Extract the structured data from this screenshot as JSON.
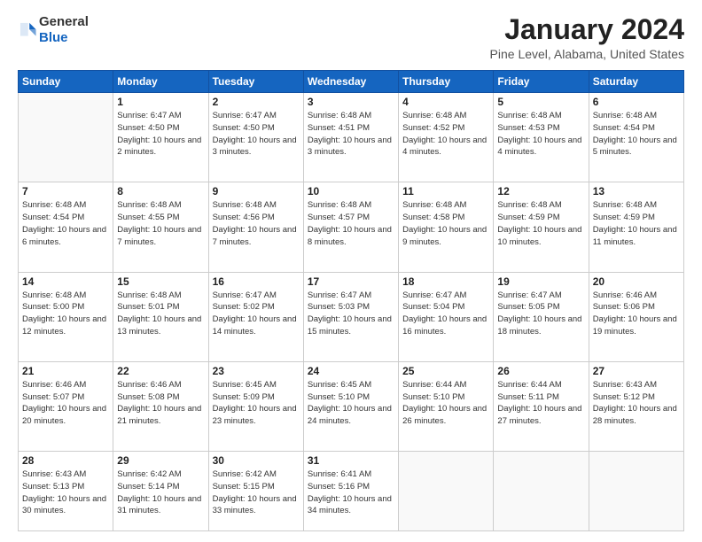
{
  "logo": {
    "general": "General",
    "blue": "Blue"
  },
  "header": {
    "month": "January 2024",
    "location": "Pine Level, Alabama, United States"
  },
  "weekdays": [
    "Sunday",
    "Monday",
    "Tuesday",
    "Wednesday",
    "Thursday",
    "Friday",
    "Saturday"
  ],
  "weeks": [
    [
      {
        "day": "",
        "sunrise": "",
        "sunset": "",
        "daylight": ""
      },
      {
        "day": "1",
        "sunrise": "Sunrise: 6:47 AM",
        "sunset": "Sunset: 4:50 PM",
        "daylight": "Daylight: 10 hours and 2 minutes."
      },
      {
        "day": "2",
        "sunrise": "Sunrise: 6:47 AM",
        "sunset": "Sunset: 4:50 PM",
        "daylight": "Daylight: 10 hours and 3 minutes."
      },
      {
        "day": "3",
        "sunrise": "Sunrise: 6:48 AM",
        "sunset": "Sunset: 4:51 PM",
        "daylight": "Daylight: 10 hours and 3 minutes."
      },
      {
        "day": "4",
        "sunrise": "Sunrise: 6:48 AM",
        "sunset": "Sunset: 4:52 PM",
        "daylight": "Daylight: 10 hours and 4 minutes."
      },
      {
        "day": "5",
        "sunrise": "Sunrise: 6:48 AM",
        "sunset": "Sunset: 4:53 PM",
        "daylight": "Daylight: 10 hours and 4 minutes."
      },
      {
        "day": "6",
        "sunrise": "Sunrise: 6:48 AM",
        "sunset": "Sunset: 4:54 PM",
        "daylight": "Daylight: 10 hours and 5 minutes."
      }
    ],
    [
      {
        "day": "7",
        "sunrise": "Sunrise: 6:48 AM",
        "sunset": "Sunset: 4:54 PM",
        "daylight": "Daylight: 10 hours and 6 minutes."
      },
      {
        "day": "8",
        "sunrise": "Sunrise: 6:48 AM",
        "sunset": "Sunset: 4:55 PM",
        "daylight": "Daylight: 10 hours and 7 minutes."
      },
      {
        "day": "9",
        "sunrise": "Sunrise: 6:48 AM",
        "sunset": "Sunset: 4:56 PM",
        "daylight": "Daylight: 10 hours and 7 minutes."
      },
      {
        "day": "10",
        "sunrise": "Sunrise: 6:48 AM",
        "sunset": "Sunset: 4:57 PM",
        "daylight": "Daylight: 10 hours and 8 minutes."
      },
      {
        "day": "11",
        "sunrise": "Sunrise: 6:48 AM",
        "sunset": "Sunset: 4:58 PM",
        "daylight": "Daylight: 10 hours and 9 minutes."
      },
      {
        "day": "12",
        "sunrise": "Sunrise: 6:48 AM",
        "sunset": "Sunset: 4:59 PM",
        "daylight": "Daylight: 10 hours and 10 minutes."
      },
      {
        "day": "13",
        "sunrise": "Sunrise: 6:48 AM",
        "sunset": "Sunset: 4:59 PM",
        "daylight": "Daylight: 10 hours and 11 minutes."
      }
    ],
    [
      {
        "day": "14",
        "sunrise": "Sunrise: 6:48 AM",
        "sunset": "Sunset: 5:00 PM",
        "daylight": "Daylight: 10 hours and 12 minutes."
      },
      {
        "day": "15",
        "sunrise": "Sunrise: 6:48 AM",
        "sunset": "Sunset: 5:01 PM",
        "daylight": "Daylight: 10 hours and 13 minutes."
      },
      {
        "day": "16",
        "sunrise": "Sunrise: 6:47 AM",
        "sunset": "Sunset: 5:02 PM",
        "daylight": "Daylight: 10 hours and 14 minutes."
      },
      {
        "day": "17",
        "sunrise": "Sunrise: 6:47 AM",
        "sunset": "Sunset: 5:03 PM",
        "daylight": "Daylight: 10 hours and 15 minutes."
      },
      {
        "day": "18",
        "sunrise": "Sunrise: 6:47 AM",
        "sunset": "Sunset: 5:04 PM",
        "daylight": "Daylight: 10 hours and 16 minutes."
      },
      {
        "day": "19",
        "sunrise": "Sunrise: 6:47 AM",
        "sunset": "Sunset: 5:05 PM",
        "daylight": "Daylight: 10 hours and 18 minutes."
      },
      {
        "day": "20",
        "sunrise": "Sunrise: 6:46 AM",
        "sunset": "Sunset: 5:06 PM",
        "daylight": "Daylight: 10 hours and 19 minutes."
      }
    ],
    [
      {
        "day": "21",
        "sunrise": "Sunrise: 6:46 AM",
        "sunset": "Sunset: 5:07 PM",
        "daylight": "Daylight: 10 hours and 20 minutes."
      },
      {
        "day": "22",
        "sunrise": "Sunrise: 6:46 AM",
        "sunset": "Sunset: 5:08 PM",
        "daylight": "Daylight: 10 hours and 21 minutes."
      },
      {
        "day": "23",
        "sunrise": "Sunrise: 6:45 AM",
        "sunset": "Sunset: 5:09 PM",
        "daylight": "Daylight: 10 hours and 23 minutes."
      },
      {
        "day": "24",
        "sunrise": "Sunrise: 6:45 AM",
        "sunset": "Sunset: 5:10 PM",
        "daylight": "Daylight: 10 hours and 24 minutes."
      },
      {
        "day": "25",
        "sunrise": "Sunrise: 6:44 AM",
        "sunset": "Sunset: 5:10 PM",
        "daylight": "Daylight: 10 hours and 26 minutes."
      },
      {
        "day": "26",
        "sunrise": "Sunrise: 6:44 AM",
        "sunset": "Sunset: 5:11 PM",
        "daylight": "Daylight: 10 hours and 27 minutes."
      },
      {
        "day": "27",
        "sunrise": "Sunrise: 6:43 AM",
        "sunset": "Sunset: 5:12 PM",
        "daylight": "Daylight: 10 hours and 28 minutes."
      }
    ],
    [
      {
        "day": "28",
        "sunrise": "Sunrise: 6:43 AM",
        "sunset": "Sunset: 5:13 PM",
        "daylight": "Daylight: 10 hours and 30 minutes."
      },
      {
        "day": "29",
        "sunrise": "Sunrise: 6:42 AM",
        "sunset": "Sunset: 5:14 PM",
        "daylight": "Daylight: 10 hours and 31 minutes."
      },
      {
        "day": "30",
        "sunrise": "Sunrise: 6:42 AM",
        "sunset": "Sunset: 5:15 PM",
        "daylight": "Daylight: 10 hours and 33 minutes."
      },
      {
        "day": "31",
        "sunrise": "Sunrise: 6:41 AM",
        "sunset": "Sunset: 5:16 PM",
        "daylight": "Daylight: 10 hours and 34 minutes."
      },
      {
        "day": "",
        "sunrise": "",
        "sunset": "",
        "daylight": ""
      },
      {
        "day": "",
        "sunrise": "",
        "sunset": "",
        "daylight": ""
      },
      {
        "day": "",
        "sunrise": "",
        "sunset": "",
        "daylight": ""
      }
    ]
  ]
}
